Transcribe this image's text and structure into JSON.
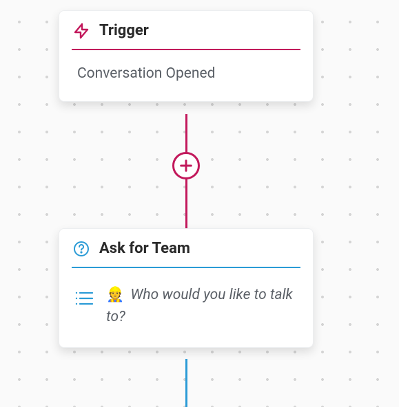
{
  "colors": {
    "trigger_accent": "#c2185b",
    "ask_accent": "#2b9bd6"
  },
  "icons": {
    "trigger": "lightning-icon",
    "ask": "question-circle-icon",
    "list": "list-icon",
    "add": "plus-icon",
    "emoji": "👷"
  },
  "nodes": {
    "trigger": {
      "title": "Trigger",
      "body": "Conversation Opened"
    },
    "ask_for_team": {
      "title": "Ask for Team",
      "prompt": "Who would you like to talk to?"
    }
  }
}
